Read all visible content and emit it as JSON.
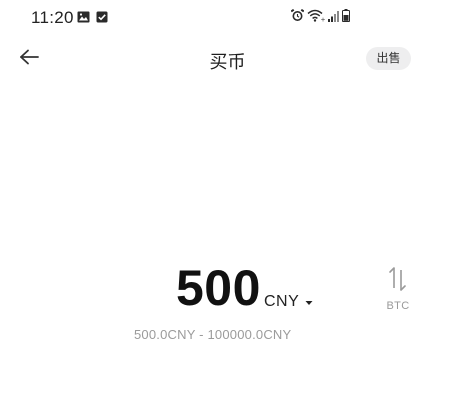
{
  "status_bar": {
    "time": "11:20",
    "left_icons": [
      "image-icon",
      "check-box-icon"
    ],
    "right_icons": [
      "alarm-icon",
      "wifi-icon",
      "signal-icon",
      "battery-icon"
    ]
  },
  "header": {
    "back_icon": "arrow-left-icon",
    "title": "买币",
    "sell_label": "出售"
  },
  "amount": {
    "value": "500",
    "currency": "CNY",
    "currency_dropdown_icon": "caret-down-icon",
    "swap_icon": "swap-vertical-icon",
    "swap_label": "BTC",
    "range": "500.0CNY - 100000.0CNY"
  },
  "colors": {
    "text_primary": "#111111",
    "text_secondary": "#9b9b9b",
    "pill_background": "#eeeeef"
  }
}
